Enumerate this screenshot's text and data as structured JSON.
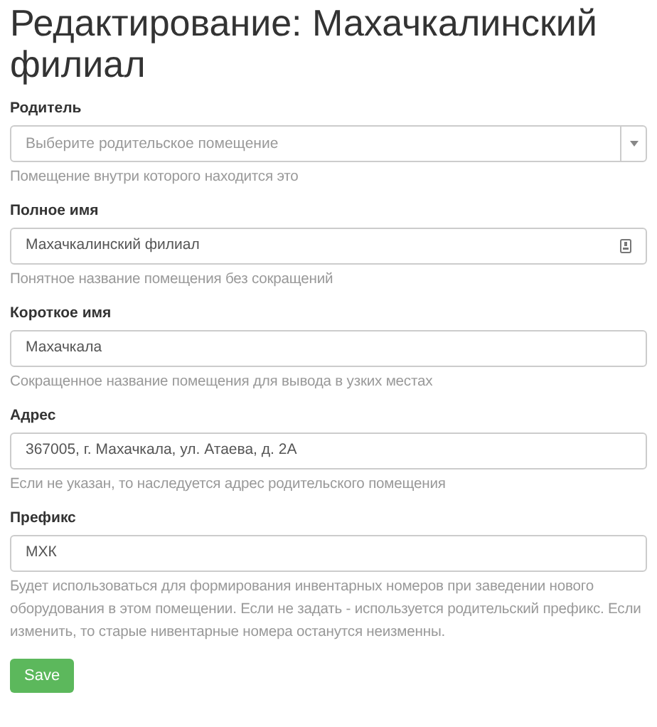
{
  "title": "Редактирование: Махачкалинский филиал",
  "fields": [
    {
      "kind": "select",
      "label": "Родитель",
      "placeholder": "Выберите родительское помещение",
      "help": "Помещение внутри которого находится это"
    },
    {
      "kind": "text_icon",
      "label": "Полное имя",
      "value": "Махачкалинский филиал",
      "help": "Понятное название помещения без сокращений"
    },
    {
      "kind": "text",
      "label": "Короткое имя",
      "value": "Махачкала",
      "help": "Сокращенное название помещения для вывода в узких местах"
    },
    {
      "kind": "text",
      "label": "Адрес",
      "value": "367005, г. Махачкала, ул. Атаева, д. 2А",
      "help": "Если не указан, то наследуется адрес родительского помещения"
    },
    {
      "kind": "text",
      "label": "Префикс",
      "value": "МХК",
      "help": "Будет использоваться для формирования инвентарных номеров при заведении нового оборудования в этом помещении. Если не задать - используется родительский префикс. Если изменить, то старые нивентарные номера останутся неизменны."
    }
  ],
  "save_button": "Save"
}
